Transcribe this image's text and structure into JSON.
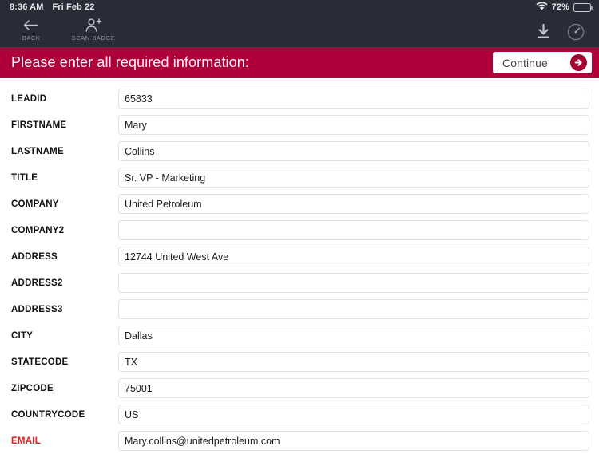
{
  "status_bar": {
    "time": "8:36 AM",
    "date": "Fri Feb 22",
    "wifi_icon": "wifi-icon",
    "battery_percent": "72%",
    "battery_icon": "battery-icon",
    "battery_level": 72
  },
  "toolbar": {
    "background_color": "#282c36",
    "items": [
      {
        "label": "BACK",
        "icon": "arrow-left-icon"
      },
      {
        "label": "SCAN BADGE",
        "icon": "person-add-icon"
      }
    ],
    "right_icons": [
      {
        "name": "download-icon"
      },
      {
        "name": "gauge-icon"
      }
    ]
  },
  "banner": {
    "title": "Please enter all required information:",
    "background_color": "#b0003a",
    "continue_label": "Continue",
    "continue_icon": "arrow-right-circle-icon"
  },
  "form": {
    "required_color": "#f01818",
    "fields": [
      {
        "label": "LEADID",
        "value": "65833",
        "required": false,
        "spellcheck_error": ""
      },
      {
        "label": "FIRSTNAME",
        "value": "Mary",
        "required": false,
        "spellcheck_error": ""
      },
      {
        "label": "LASTNAME",
        "value": "Collins",
        "required": false,
        "spellcheck_error": ""
      },
      {
        "label": "TITLE",
        "value": "Sr. VP - Marketing",
        "required": false,
        "spellcheck_error": ""
      },
      {
        "label": "COMPANY",
        "value": "United Petroleum",
        "required": false,
        "spellcheck_error": ""
      },
      {
        "label": "COMPANY2",
        "value": "",
        "required": false,
        "spellcheck_error": ""
      },
      {
        "label": "ADDRESS",
        "value": "12744 United West Ave",
        "required": false,
        "spellcheck_error": ""
      },
      {
        "label": "ADDRESS2",
        "value": "",
        "required": false,
        "spellcheck_error": ""
      },
      {
        "label": "ADDRESS3",
        "value": "",
        "required": false,
        "spellcheck_error": ""
      },
      {
        "label": "CITY",
        "value": "Dallas",
        "required": false,
        "spellcheck_error": ""
      },
      {
        "label": "STATECODE",
        "value": "TX",
        "required": false,
        "spellcheck_error": ""
      },
      {
        "label": "ZIPCODE",
        "value": "75001",
        "required": false,
        "spellcheck_error": ""
      },
      {
        "label": "COUNTRYCODE",
        "value": "US",
        "required": false,
        "spellcheck_error": ""
      },
      {
        "label": "EMAIL",
        "value": "Mary.collins@unitedpetroleum.com",
        "required": true,
        "spellcheck_error": "unitedpetroleum"
      }
    ]
  }
}
